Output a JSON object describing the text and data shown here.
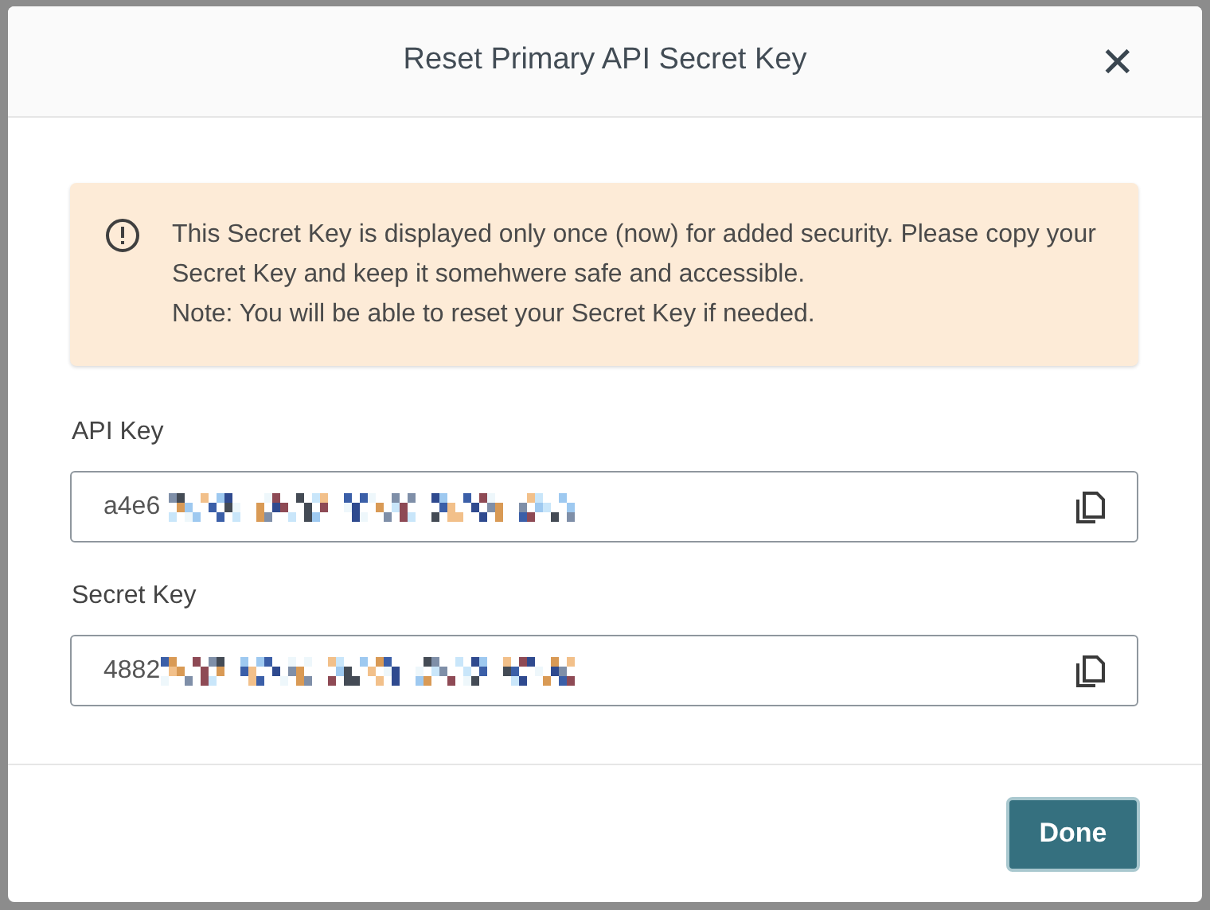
{
  "dialog": {
    "title": "Reset Primary API Secret Key",
    "close": "✕"
  },
  "notice": {
    "text": "This Secret Key is displayed only once (now) for added security. Please copy your Secret Key and keep it somehwere safe and accessible.\nNote: You will be able to reset your Secret Key if needed."
  },
  "fields": [
    {
      "label": "API Key",
      "value": "a4e6"
    },
    {
      "label": "Secret Key",
      "value": "4882"
    }
  ],
  "buttons": [
    {
      "label": "Done"
    }
  ]
}
